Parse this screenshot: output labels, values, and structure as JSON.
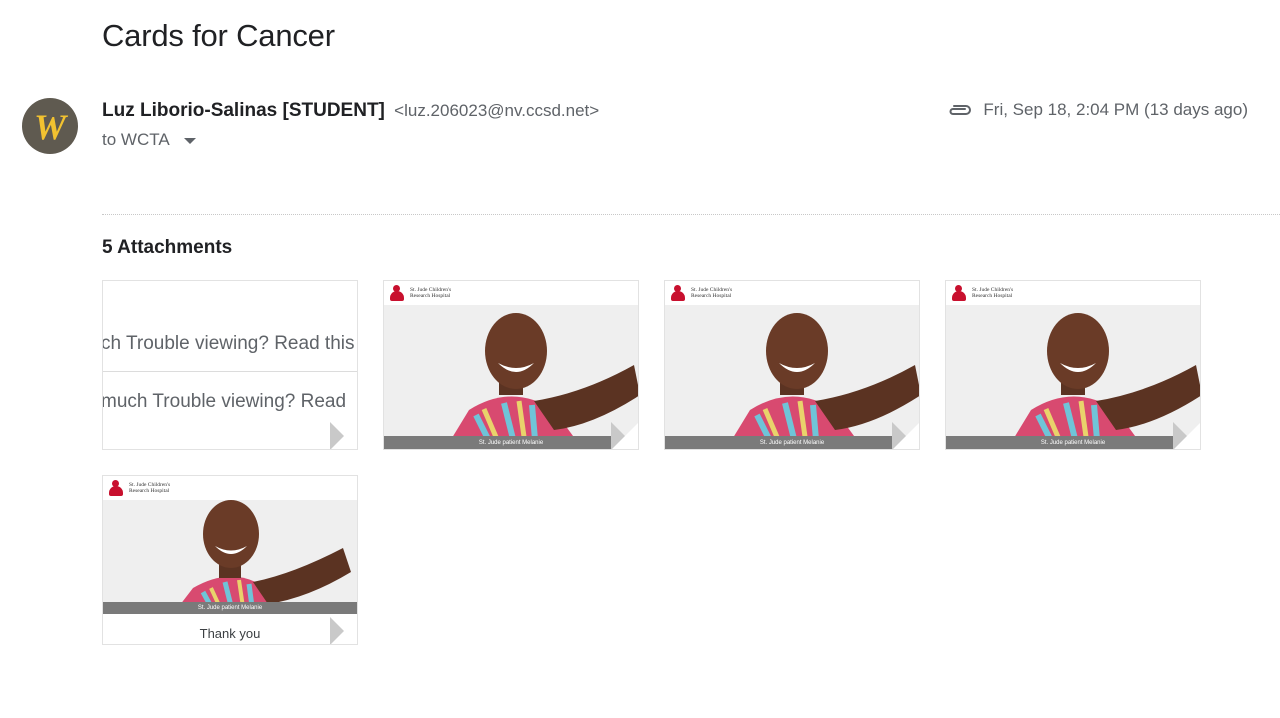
{
  "email": {
    "subject": "Cards for Cancer",
    "sender_name": "Luz Liborio-Salinas [STUDENT]",
    "sender_email": "<luz.206023@nv.ccsd.net>",
    "recipients": "to WCTA",
    "date": "Fri, Sep 18, 2:04 PM (13 days ago)",
    "avatar_letter": "W"
  },
  "attachments": {
    "heading": "5 Attachments",
    "doc_line_1": "ch Trouble viewing? Read this",
    "doc_line_2": "much Trouble viewing? Read",
    "logo_text_1": "St. Jude Children's",
    "logo_text_2": "Research Hospital",
    "photo_caption": "St. Jude patient Melanie",
    "thank_you": "Thank you"
  },
  "colors": {
    "brand_red": "#c8102e",
    "avatar_bg": "#5f5a50",
    "avatar_letter": "#f2c230"
  },
  "icons": [
    "paperclip-icon",
    "chevron-down-icon",
    "st-jude-logo"
  ]
}
